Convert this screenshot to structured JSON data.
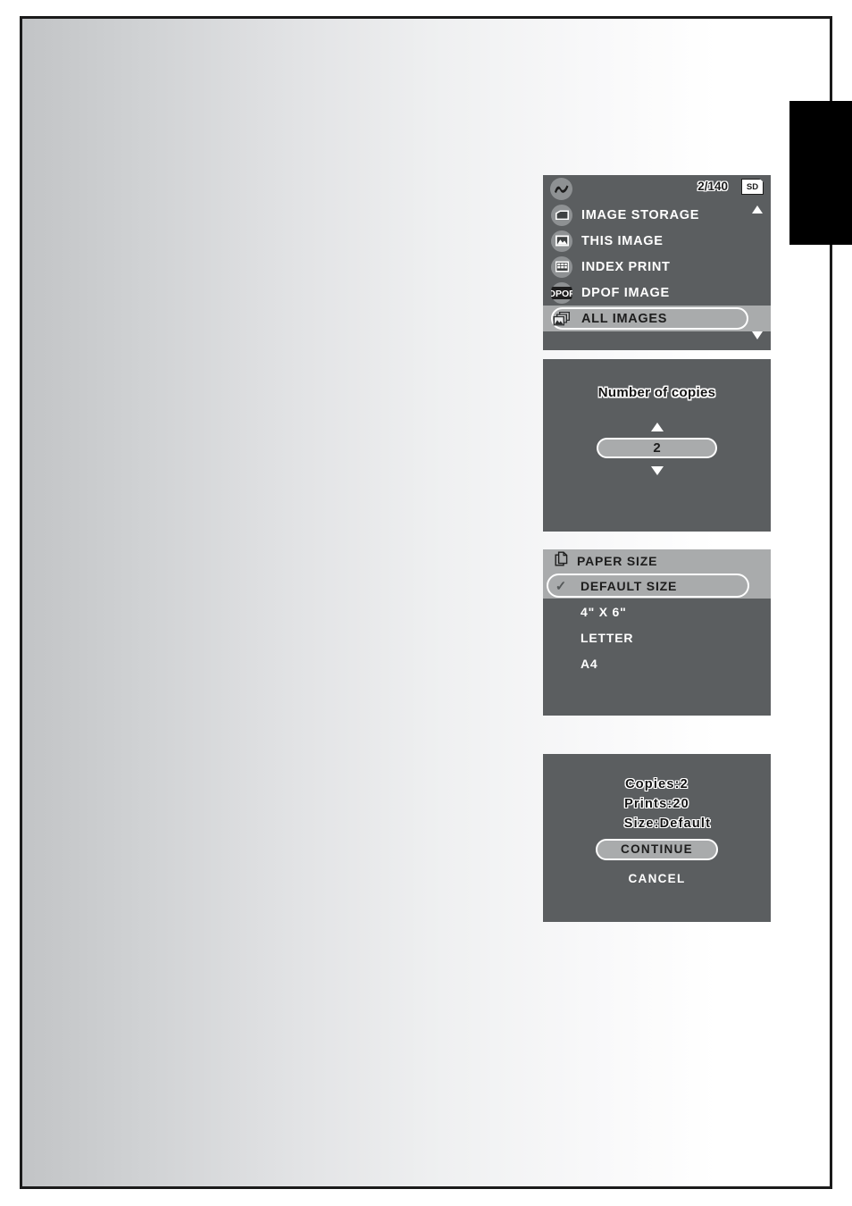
{
  "page": {
    "thumb_tab": "chapter-thumb-tab"
  },
  "print_menu": {
    "brand_icon": "nikon-swoosh-icon",
    "frame_count": "2/140",
    "card_badge": "SD",
    "scroll_up": "scroll-up-arrow",
    "scroll_down": "scroll-down-arrow",
    "items": [
      {
        "label": "IMAGE STORAGE",
        "icon": "folder-icon",
        "selected": false
      },
      {
        "label": "THIS IMAGE",
        "icon": "single-photo-icon",
        "selected": false
      },
      {
        "label": "INDEX PRINT",
        "icon": "grid-icon",
        "selected": false
      },
      {
        "label": "DPOF IMAGE",
        "icon": "dpof-icon",
        "selected": false
      },
      {
        "label": "ALL IMAGES",
        "icon": "photo-stack-icon",
        "selected": true
      }
    ]
  },
  "copies_panel": {
    "title": "Number of copies",
    "value": "2",
    "increment_icon": "up-triangle-icon",
    "decrement_icon": "down-triangle-icon"
  },
  "paper_panel": {
    "header": "PAPER SIZE",
    "header_icon": "paper-sheets-icon",
    "check_glyph": "✓",
    "options": [
      {
        "label": "DEFAULT SIZE",
        "selected": true
      },
      {
        "label": "4\" X 6\"",
        "selected": false
      },
      {
        "label": "LETTER",
        "selected": false
      },
      {
        "label": "A4",
        "selected": false
      }
    ]
  },
  "summary_panel": {
    "copies": "Copies:2",
    "prints": "Prints:20",
    "size": "Size:Default",
    "continue_label": "CONTINUE",
    "cancel_label": "CANCEL"
  },
  "colors": {
    "lcd_background": "#5b5e60",
    "lcd_highlight": "#a9abac",
    "icon_circle": "#8e9193",
    "page_border": "#1b1b1b",
    "tab_black": "#000000"
  }
}
